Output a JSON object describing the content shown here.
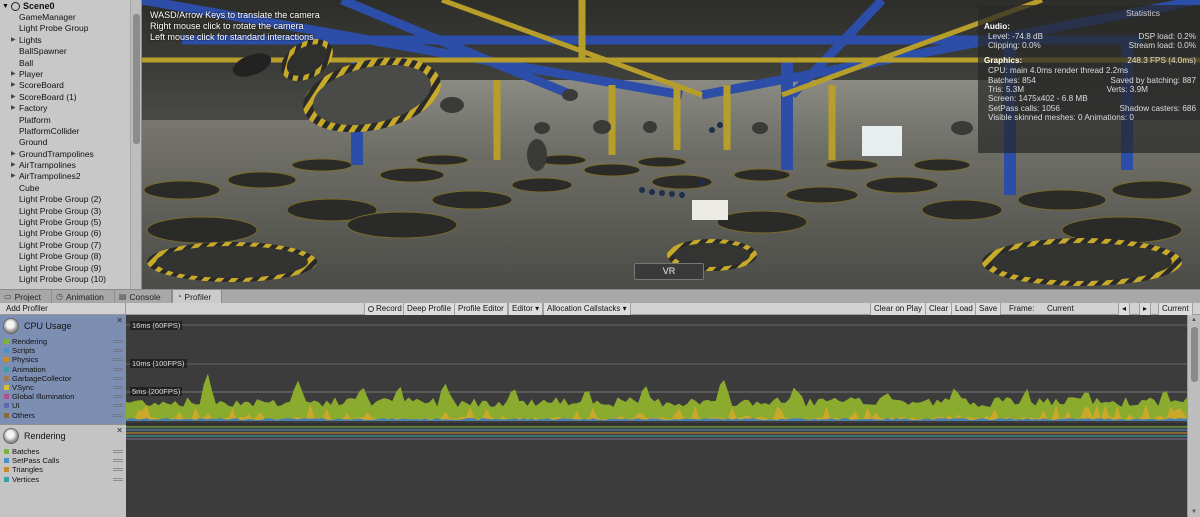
{
  "hierarchy": {
    "scene_name": "Scene0",
    "items": [
      {
        "label": "GameManager",
        "expandable": false
      },
      {
        "label": "Light Probe Group",
        "expandable": false
      },
      {
        "label": "Lights",
        "expandable": true
      },
      {
        "label": "BallSpawner",
        "expandable": false
      },
      {
        "label": "Ball",
        "expandable": false
      },
      {
        "label": "Player",
        "expandable": true
      },
      {
        "label": "ScoreBoard",
        "expandable": true
      },
      {
        "label": "ScoreBoard (1)",
        "expandable": true
      },
      {
        "label": "Factory",
        "expandable": true
      },
      {
        "label": "Platform",
        "expandable": false
      },
      {
        "label": "PlatformCollider",
        "expandable": false
      },
      {
        "label": "Ground",
        "expandable": false
      },
      {
        "label": "GroundTrampolines",
        "expandable": true
      },
      {
        "label": "AirTrampolines",
        "expandable": true
      },
      {
        "label": "AirTrampolines2",
        "expandable": true
      },
      {
        "label": "Cube",
        "expandable": false
      },
      {
        "label": "Light Probe Group (2)",
        "expandable": false
      },
      {
        "label": "Light Probe Group (3)",
        "expandable": false
      },
      {
        "label": "Light Probe Group (5)",
        "expandable": false
      },
      {
        "label": "Light Probe Group (6)",
        "expandable": false
      },
      {
        "label": "Light Probe Group (7)",
        "expandable": false
      },
      {
        "label": "Light Probe Group (8)",
        "expandable": false
      },
      {
        "label": "Light Probe Group (9)",
        "expandable": false
      },
      {
        "label": "Light Probe Group (10)",
        "expandable": false
      }
    ]
  },
  "game": {
    "help_lines": [
      "WASD/Arrow Keys to translate the camera",
      "Right mouse click to rotate the camera",
      "Left mouse click for standard interactions"
    ],
    "vr_button": "VR",
    "stats": {
      "title": "Statistics",
      "audio_label": "Audio:",
      "level": "Level: -74.8 dB",
      "dsp_load": "DSP load: 0.2%",
      "clipping": "Clipping: 0.0%",
      "stream_load": "Stream load: 0.0%",
      "graphics_label": "Graphics:",
      "fps": "248.3 FPS (4.0ms)",
      "cpu": "CPU: main 4.0ms  render thread 2.2ms",
      "batches": "Batches: 854",
      "saved_batching": "Saved by batching: 887",
      "tris": "Tris: 5.3M",
      "verts": "Verts: 3.9M",
      "screen": "Screen: 1475x402 - 6.8 MB",
      "setpass": "SetPass calls: 1056",
      "shadow_casters": "Shadow casters: 686",
      "skinned": "Visible skinned meshes: 0  Animations: 0"
    }
  },
  "tabs": [
    {
      "label": "Project",
      "icon": "folder-icon",
      "active": false
    },
    {
      "label": "Animation",
      "icon": "clock-icon",
      "active": false
    },
    {
      "label": "Console",
      "icon": "console-icon",
      "active": false
    },
    {
      "label": "Profiler",
      "icon": "profiler-icon",
      "active": true
    }
  ],
  "profiler_toolbar": {
    "add_profiler": "Add Profiler",
    "record": "Record",
    "deep_profile": "Deep Profile",
    "profile_editor": "Profile Editor",
    "editor": "Editor",
    "allocation_callstacks": "Allocation Callstacks",
    "clear_on_play": "Clear on Play",
    "clear": "Clear",
    "load": "Load",
    "save": "Save",
    "frame_label": "Frame:",
    "frame_value": "Current",
    "current": "Current"
  },
  "profiler": {
    "cpu_title": "CPU Usage",
    "cpu_legend": [
      {
        "label": "Rendering",
        "color": "#7ab43e"
      },
      {
        "label": "Scripts",
        "color": "#4a90c8"
      },
      {
        "label": "Physics",
        "color": "#c88a2c"
      },
      {
        "label": "Animation",
        "color": "#3aa0a8"
      },
      {
        "label": "GarbageCollector",
        "color": "#a07a50"
      },
      {
        "label": "VSync",
        "color": "#d6c23a"
      },
      {
        "label": "Global Illumination",
        "color": "#b0508a"
      },
      {
        "label": "UI",
        "color": "#5a6ab0"
      },
      {
        "label": "Others",
        "color": "#8a6a3a"
      }
    ],
    "rendering_title": "Rendering",
    "rendering_legend": [
      {
        "label": "Batches",
        "color": "#7ab43e"
      },
      {
        "label": "SetPass Calls",
        "color": "#4a90c8"
      },
      {
        "label": "Triangles",
        "color": "#c88a2c"
      },
      {
        "label": "Vertices",
        "color": "#3aa0a8"
      }
    ],
    "ms_labels": [
      "16ms (60FPS)",
      "10ms (100FPS)",
      "5ms (200FPS)"
    ]
  }
}
